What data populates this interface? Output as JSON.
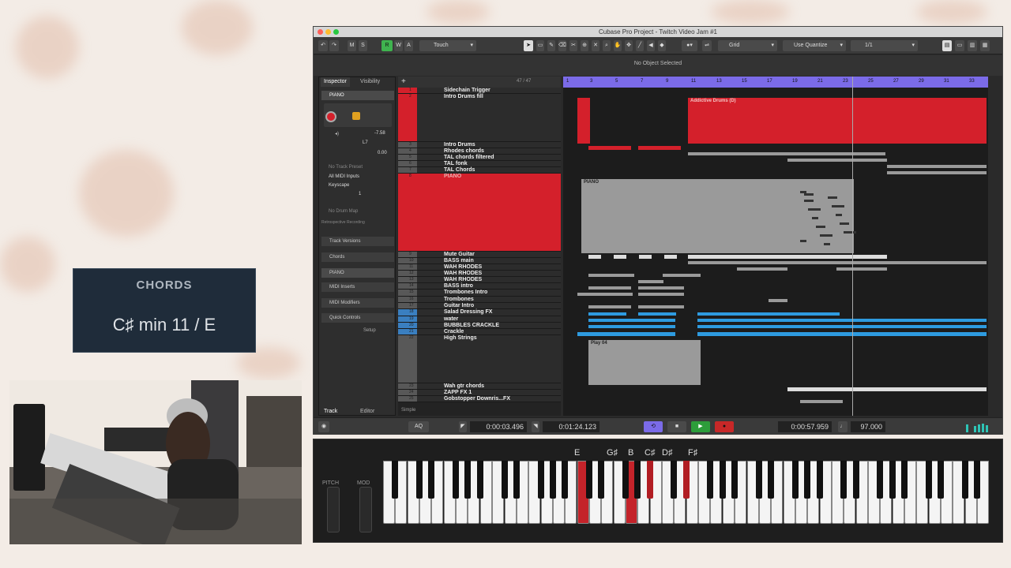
{
  "window": {
    "title": "Cubase Pro Project - Twitch Video Jam #1",
    "info_line": "No Object Selected"
  },
  "chords_overlay": {
    "title": "CHORDS",
    "value": "C♯ min 11 / E"
  },
  "toolbar": {
    "buttons": [
      "M",
      "S",
      "R",
      "W",
      "A"
    ],
    "automation_mode": "Touch",
    "snap_type": "Grid",
    "quantize_mode": "Use Quantize",
    "quantize_value": "1/1"
  },
  "inspector": {
    "tabs": [
      "Inspector",
      "Visibility"
    ],
    "track_name": "PIANO",
    "volume": "-7.58",
    "pan": "L7",
    "delay": "0.00",
    "preset": "No Track Preset",
    "input": "All MIDI Inputs",
    "output": "Keyscape",
    "channel": "1",
    "drum_map": "No Drum Map",
    "retro": "Retrospective Recording",
    "sections": [
      "Track Versions",
      "Chords",
      "PIANO",
      "MIDI Inserts",
      "MIDI Modifiers",
      "Quick Controls"
    ],
    "setup": "Setup",
    "bottom_tabs": [
      "Track",
      "Editor"
    ]
  },
  "tracklist": {
    "count": "47 / 47",
    "footer": "Simple",
    "tracks": [
      {
        "num": "1",
        "name": "Sidechain Trigger"
      },
      {
        "num": "2",
        "name": "Intro Drums fill"
      },
      {
        "num": "3",
        "name": "Intro Drums"
      },
      {
        "num": "4",
        "name": "Rhodes chords"
      },
      {
        "num": "5",
        "name": "TAL chords filtered"
      },
      {
        "num": "6",
        "name": "TAL fonk"
      },
      {
        "num": "7",
        "name": "TAL Chords"
      },
      {
        "num": "8",
        "name": "PIANO"
      },
      {
        "num": "9",
        "name": "Mute Guitar"
      },
      {
        "num": "10",
        "name": "BASS main"
      },
      {
        "num": "11",
        "name": "WAH RHODES"
      },
      {
        "num": "12",
        "name": "WAH RHODES"
      },
      {
        "num": "13",
        "name": "WAH RHODES"
      },
      {
        "num": "14",
        "name": "BASS intro"
      },
      {
        "num": "15",
        "name": "Trombones Intro"
      },
      {
        "num": "16",
        "name": "Trombones"
      },
      {
        "num": "17",
        "name": "Guitar Intro"
      },
      {
        "num": "18",
        "name": "Salad Dressing FX"
      },
      {
        "num": "19",
        "name": "water"
      },
      {
        "num": "20",
        "name": "BUBBLES CRACKLE"
      },
      {
        "num": "21",
        "name": "Crackle"
      },
      {
        "num": "22",
        "name": "High Strings"
      },
      {
        "num": "23",
        "name": "Wah gtr chords"
      },
      {
        "num": "24",
        "name": "ZAPP FX 1"
      },
      {
        "num": "25",
        "name": "Gobstopper Downris...FX"
      }
    ]
  },
  "ruler": {
    "marks": [
      "1",
      "3",
      "5",
      "7",
      "9",
      "11",
      "13",
      "15",
      "17",
      "19",
      "21",
      "23",
      "25",
      "27",
      "29",
      "31",
      "33"
    ]
  },
  "clips": {
    "drums": "Addictive Drums (D)",
    "piano": "PIANO",
    "strings": "Play 04"
  },
  "transport": {
    "left_locator": "0:00:03.496",
    "right_locator": "0:01:24.123",
    "position": "0:00:57.959",
    "tempo": "97.000",
    "aq": "AQ"
  },
  "keyboard": {
    "wheels": [
      "PITCH",
      "MOD"
    ],
    "held_notes": [
      "E",
      "G♯",
      "B",
      "C♯",
      "D♯",
      "F♯"
    ]
  },
  "colors": {
    "red_track": "#d4202b",
    "ruler": "#7b6be8",
    "blue_clip": "#2e9be0",
    "gray_clip": "#9a9a9a"
  }
}
